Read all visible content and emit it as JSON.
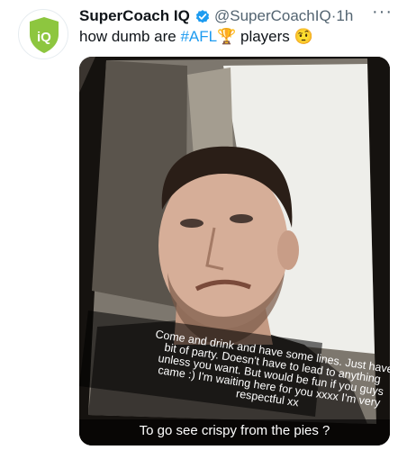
{
  "tweet": {
    "display_name": "SuperCoach IQ",
    "handle": "@SuperCoachIQ",
    "separator": "·",
    "time": "1h",
    "more_icon": "more-horizontal-icon",
    "text_before": "how dumb are ",
    "hashtag": "#AFL",
    "trophy_emoji": "🏆",
    "text_after": " players ",
    "emoji": "🤨"
  },
  "avatar": {
    "icon": "supercoach-iq-logo",
    "logo_text": "iQ",
    "brand_color": "#8dc63f"
  },
  "media": {
    "phone_message": "Come and drink and have some lines. Just have bit of party. Doesn't have to lead to anything unless you want. But would be fun if you guys came :) I'm waiting here for you xxxx I'm very respectful xx",
    "caption": "To go see crispy from the pies ?"
  },
  "colors": {
    "link": "#1d9bf0",
    "verified": "#1d9bf0",
    "muted": "#536471",
    "text": "#0f1419"
  }
}
